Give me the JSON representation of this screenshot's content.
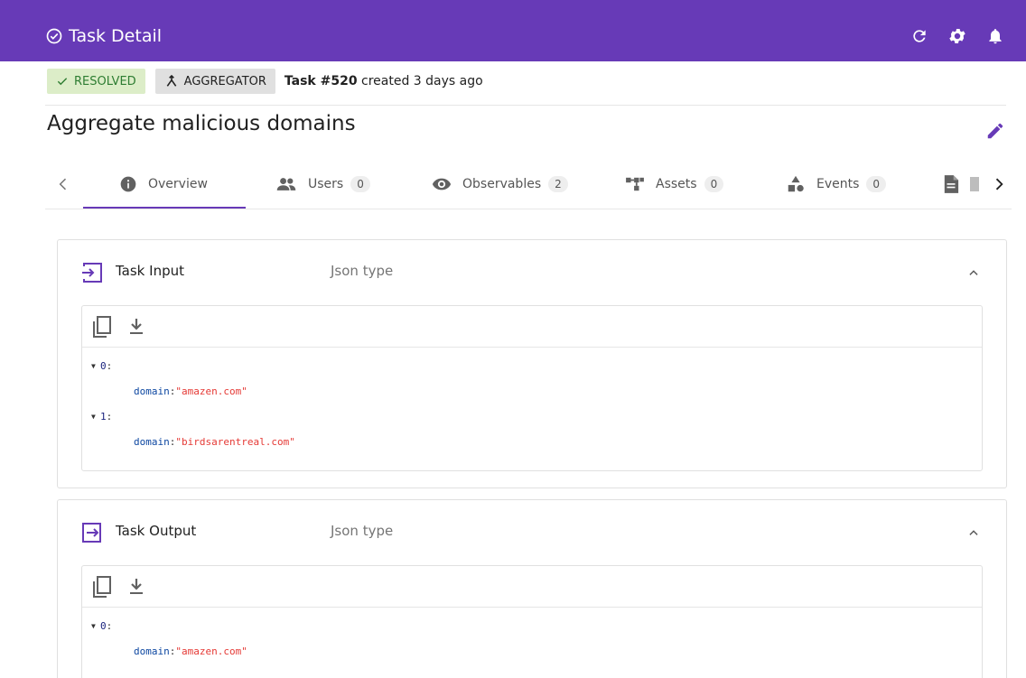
{
  "header": {
    "title": "Task Detail",
    "icons": [
      "check-circle-icon",
      "refresh-icon",
      "gear-icon",
      "bell-icon"
    ]
  },
  "meta": {
    "status_label": "RESOLVED",
    "type_label": "AGGREGATOR",
    "task_number": "Task #520",
    "created_text": "created 3 days ago"
  },
  "task": {
    "title": "Aggregate malicious domains"
  },
  "tabs": [
    {
      "label": "Overview",
      "icon": "info-icon",
      "count": ""
    },
    {
      "label": "Users",
      "icon": "users-icon",
      "count": "0"
    },
    {
      "label": "Observables",
      "icon": "eye-icon",
      "count": "2"
    },
    {
      "label": "Assets",
      "icon": "assets-icon",
      "count": "0"
    },
    {
      "label": "Events",
      "icon": "shapes-icon",
      "count": "0"
    },
    {
      "label": "",
      "icon": "document-icon",
      "count": ""
    }
  ],
  "input_panel": {
    "title": "Task Input",
    "type_label": "Json type",
    "items": [
      {
        "index": "0",
        "key": "domain",
        "value": "\"amazen.com\""
      },
      {
        "index": "1",
        "key": "domain",
        "value": "\"birdsarentreal.com\""
      }
    ]
  },
  "output_panel": {
    "title": "Task Output",
    "type_label": "Json type",
    "items": [
      {
        "index": "0",
        "key": "domain",
        "value": "\"amazen.com\""
      }
    ]
  },
  "colors": {
    "primary": "#673ab7",
    "resolved_bg": "#dcedc8",
    "resolved_text": "#2e7d32",
    "json_string": "#e53935"
  }
}
